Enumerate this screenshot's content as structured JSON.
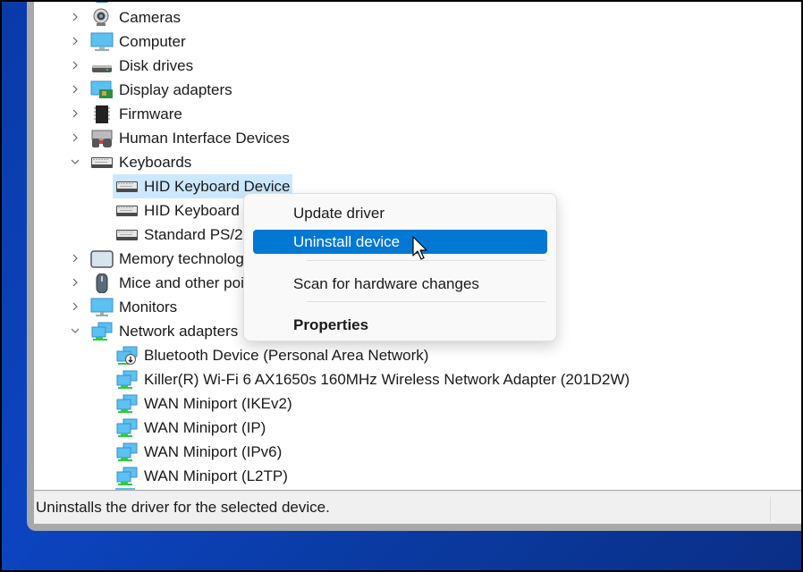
{
  "tree": {
    "items": [
      {
        "label": "Cameras",
        "icon": "camera-icon",
        "expanded": false,
        "level": 0
      },
      {
        "label": "Computer",
        "icon": "computer-icon",
        "expanded": false,
        "level": 0
      },
      {
        "label": "Disk drives",
        "icon": "disk-drive-icon",
        "expanded": false,
        "level": 0
      },
      {
        "label": "Display adapters",
        "icon": "display-adapter-icon",
        "expanded": false,
        "level": 0
      },
      {
        "label": "Firmware",
        "icon": "firmware-chip-icon",
        "expanded": false,
        "level": 0
      },
      {
        "label": "Human Interface Devices",
        "icon": "hid-icon",
        "expanded": false,
        "level": 0
      },
      {
        "label": "Keyboards",
        "icon": "keyboard-icon",
        "expanded": true,
        "level": 0
      },
      {
        "label": "HID Keyboard Device",
        "icon": "keyboard-icon",
        "level": 1,
        "selected": true
      },
      {
        "label": "HID Keyboard Device",
        "icon": "keyboard-icon",
        "level": 1
      },
      {
        "label": "Standard PS/2 Keyboard",
        "icon": "keyboard-icon",
        "level": 1
      },
      {
        "label": "Memory technology devices",
        "icon": "memory-device-icon",
        "expanded": false,
        "level": 0
      },
      {
        "label": "Mice and other pointing devices",
        "icon": "mouse-icon",
        "expanded": false,
        "level": 0
      },
      {
        "label": "Monitors",
        "icon": "monitor-icon",
        "expanded": false,
        "level": 0
      },
      {
        "label": "Network adapters",
        "icon": "network-adapter-icon",
        "expanded": true,
        "level": 0
      },
      {
        "label": "Bluetooth Device (Personal Area Network)",
        "icon": "bluetooth-network-icon",
        "level": 1
      },
      {
        "label": "Killer(R) Wi-Fi 6 AX1650s 160MHz Wireless Network Adapter (201D2W)",
        "icon": "network-adapter-icon",
        "level": 1
      },
      {
        "label": "WAN Miniport (IKEv2)",
        "icon": "network-adapter-icon",
        "level": 1
      },
      {
        "label": "WAN Miniport (IP)",
        "icon": "network-adapter-icon",
        "level": 1
      },
      {
        "label": "WAN Miniport (IPv6)",
        "icon": "network-adapter-icon",
        "level": 1
      },
      {
        "label": "WAN Miniport (L2TP)",
        "icon": "network-adapter-icon",
        "level": 1
      }
    ]
  },
  "context_menu": {
    "items": [
      {
        "label": "Update driver"
      },
      {
        "label": "Uninstall device",
        "highlighted": true
      },
      {
        "label": "Scan for hardware changes"
      },
      {
        "label": "Properties",
        "bold": true
      }
    ]
  },
  "status_bar": {
    "text": "Uninstalls the driver for the selected device."
  },
  "colors": {
    "selection": "#cce8ff",
    "menu_highlight": "#0078d4",
    "desktop": "#0c44c0"
  }
}
